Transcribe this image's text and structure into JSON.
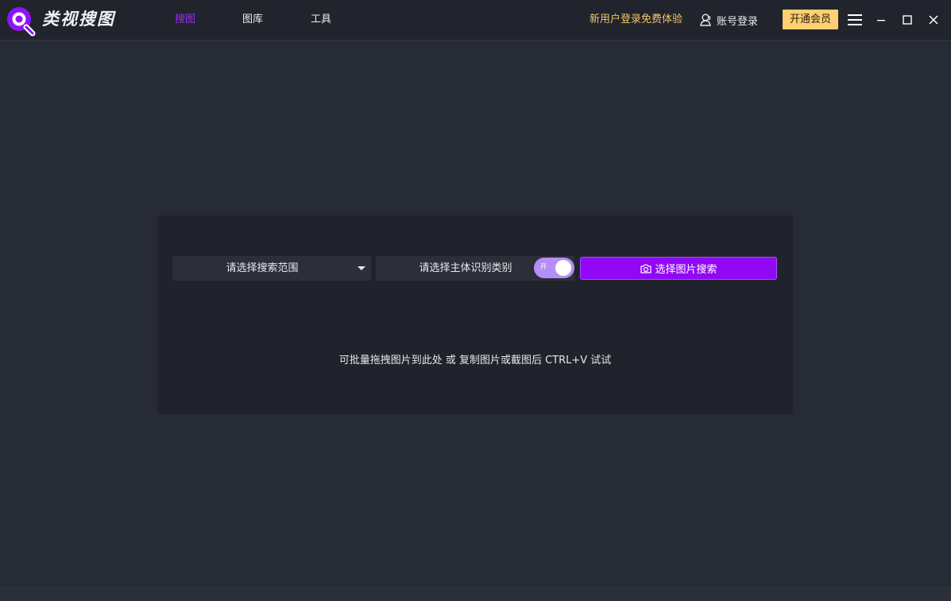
{
  "app": {
    "brand": "类视搜图",
    "colors": {
      "accent": "#9d2bff",
      "primary_button": "#9108f5",
      "promo": "#f3c56c",
      "vip_button": "#ffcf72",
      "toggle_on": "#b58ef9",
      "background": "#272b35",
      "titlebar": "#21242c",
      "panel": "#21232c"
    }
  },
  "header": {
    "tabs": [
      {
        "label": "搜图",
        "active": true
      },
      {
        "label": "图库",
        "active": false
      },
      {
        "label": "工具",
        "active": false
      }
    ],
    "promo": "新用户登录免费体验",
    "account_label": "账号登录",
    "account_icon": "user-icon",
    "vip_label": "开通会员",
    "window_icons": [
      "menu-icon",
      "minimize-icon",
      "maximize-icon",
      "close-icon"
    ]
  },
  "search_panel": {
    "scope_select": {
      "selected": "请选择搜索范围"
    },
    "category_select": {
      "selected": "请选择主体识别类别"
    },
    "toggle": {
      "label": "开",
      "on": true
    },
    "search_button": {
      "label": "选择图片搜索",
      "icon": "camera-icon"
    },
    "hint": "可批量拖拽图片到此处 或 复制图片或截图后 CTRL+V 试试"
  }
}
